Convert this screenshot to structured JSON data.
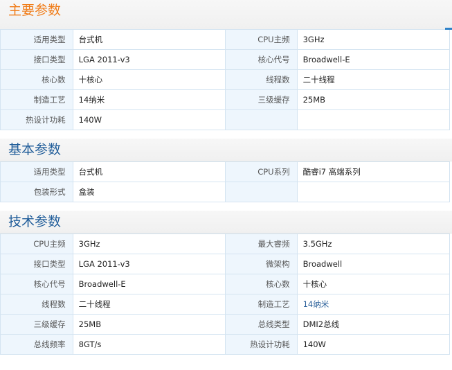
{
  "sections": [
    {
      "title": "主要参数",
      "rows": [
        [
          {
            "k": "适用类型",
            "v": "台式机"
          },
          {
            "k": "CPU主频",
            "v": "3GHz"
          }
        ],
        [
          {
            "k": "接口类型",
            "v": "LGA 2011-v3"
          },
          {
            "k": "核心代号",
            "v": "Broadwell-E"
          }
        ],
        [
          {
            "k": "核心数",
            "v": "十核心"
          },
          {
            "k": "线程数",
            "v": "二十线程"
          }
        ],
        [
          {
            "k": "制造工艺",
            "v": "14纳米"
          },
          {
            "k": "三级缓存",
            "v": "25MB"
          }
        ],
        [
          {
            "k": "热设计功耗",
            "v": "140W"
          },
          {
            "k": "",
            "v": ""
          }
        ]
      ]
    },
    {
      "title": "基本参数",
      "rows": [
        [
          {
            "k": "适用类型",
            "v": "台式机"
          },
          {
            "k": "CPU系列",
            "v": "酷睿i7 高端系列"
          }
        ],
        [
          {
            "k": "包装形式",
            "v": "盒装"
          },
          {
            "k": "",
            "v": ""
          }
        ]
      ]
    },
    {
      "title": "技术参数",
      "rows": [
        [
          {
            "k": "CPU主频",
            "v": "3GHz"
          },
          {
            "k": "最大睿频",
            "v": "3.5GHz"
          }
        ],
        [
          {
            "k": "接口类型",
            "v": "LGA 2011-v3"
          },
          {
            "k": "微架构",
            "v": "Broadwell"
          }
        ],
        [
          {
            "k": "核心代号",
            "v": "Broadwell-E"
          },
          {
            "k": "核心数",
            "v": "十核心"
          }
        ],
        [
          {
            "k": "线程数",
            "v": "二十线程"
          },
          {
            "k": "制造工艺",
            "v": "14纳米"
          }
        ],
        [
          {
            "k": "三级缓存",
            "v": "25MB"
          },
          {
            "k": "总线类型",
            "v": "DMI2总线"
          }
        ],
        [
          {
            "k": "总线频率",
            "v": "8GT/s"
          },
          {
            "k": "热设计功耗",
            "v": "140W"
          }
        ]
      ]
    }
  ],
  "colors": {
    "title_orange": "#f07d1a",
    "title_blue": "#1f5c99",
    "key_bg": "#eef6fd",
    "border": "#d4e4f1",
    "link": "#2a5f99"
  }
}
